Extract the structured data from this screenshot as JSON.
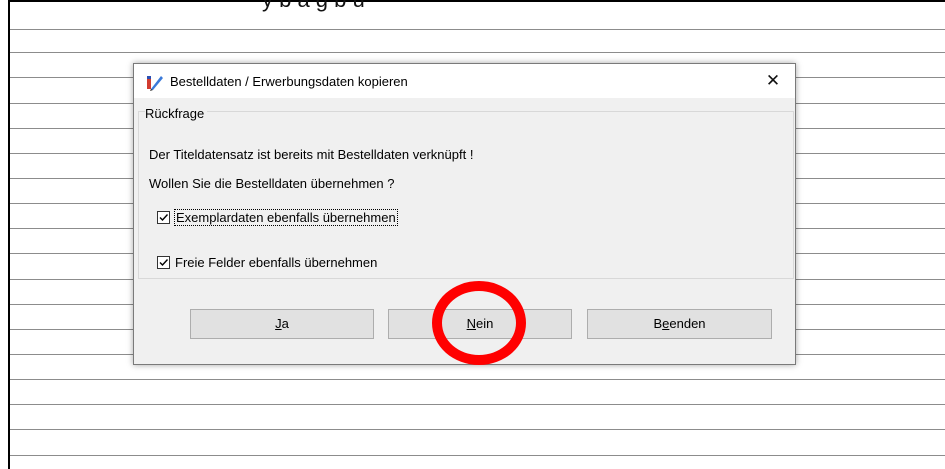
{
  "background_caption": "y b   ä   g b      ü",
  "dialog": {
    "title": "Bestelldaten / Erwerbungsdaten kopieren",
    "close_symbol": "✕",
    "group_label": "Rückfrage",
    "message_1": "Der Titeldatensatz ist bereits mit Bestelldaten verknüpft !",
    "message_2": "Wollen Sie die Bestelldaten übernehmen ?",
    "checkbox_1": {
      "label": "Exemplardaten ebenfalls übernehmen",
      "checked": true
    },
    "checkbox_2": {
      "label": "Freie Felder ebenfalls übernehmen",
      "checked": true
    },
    "buttons": {
      "ja": {
        "mnemonic": "J",
        "rest": "a"
      },
      "nein": {
        "mnemonic": "N",
        "rest": "ein"
      },
      "beenden": {
        "prefix": "B",
        "mnemonic": "e",
        "rest": "enden"
      }
    }
  },
  "icons": {
    "app_icon": "pen-edit-icon",
    "close_icon": "close-icon",
    "check_icon": "checkmark-icon"
  },
  "colors": {
    "highlight_ring": "#ff0000",
    "dialog_bg": "#f0f0f0",
    "button_bg": "#e1e1e1"
  }
}
